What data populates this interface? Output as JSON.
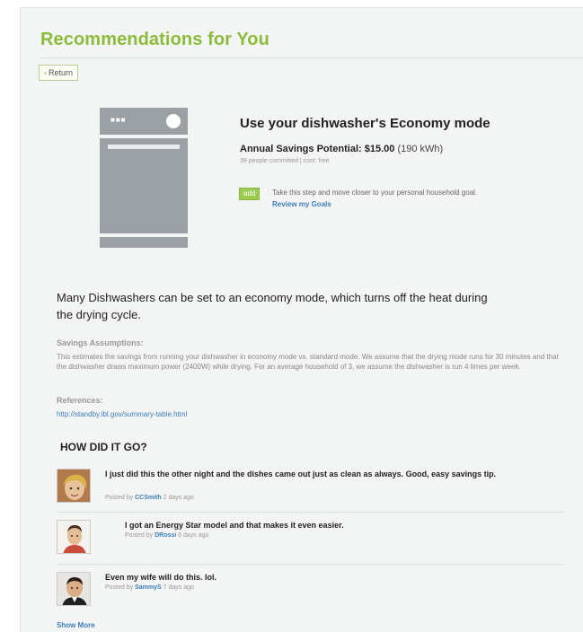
{
  "header": {
    "title": "Recommendations for You",
    "return_label": "Return"
  },
  "icons": {
    "return": "chevron-left-icon",
    "product": "dishwasher-icon"
  },
  "recommendation": {
    "heading": "Use your dishwasher's Economy mode",
    "savings_label": "Annual Savings Potential: $15.00",
    "savings_kwh": "(190 kWh)",
    "committed": "39 people committed | cost: free",
    "add_label": "add",
    "add_text": "Take this step and move closer to your personal household goal.",
    "review_link": "Review my Goals"
  },
  "description": "Many Dishwashers can be set to an economy mode, which turns off the heat during the drying cycle.",
  "assumptions": {
    "label": "Savings Assumptions:",
    "text": "This estimates the savings from running your dishwasher in economy mode vs. standard mode. We assume that the drying mode runs for 30 minutes and that the dishwasher draws maximum power (2400W) while drying. For an average household of 3, we assume the dishwasher is run 4 times per week."
  },
  "references": {
    "label": "References:",
    "link": "http://standby.lbl.gov/summary-table.html"
  },
  "feedback": {
    "heading": "HOW DID IT GO?",
    "posted_by": "Posted by",
    "comments": [
      {
        "text": "I just did this the other night and the dishes came out just as clean as always. Good, easy savings tip.",
        "user": "CCSmith",
        "time": "2 days ago"
      },
      {
        "text": "I got an Energy Star model and that makes it even easier.",
        "user": "DRossi",
        "time": "6 days ago"
      },
      {
        "text": "Even my wife will do this. lol.",
        "user": "SammyS",
        "time": "7 days ago"
      }
    ],
    "show_more": "Show More"
  },
  "colors": {
    "brand_green": "#8dbb3c",
    "link_blue": "#3d7fb5",
    "illustration_gray": "#9aa0a3",
    "page_bg": "#f3f4f4"
  }
}
